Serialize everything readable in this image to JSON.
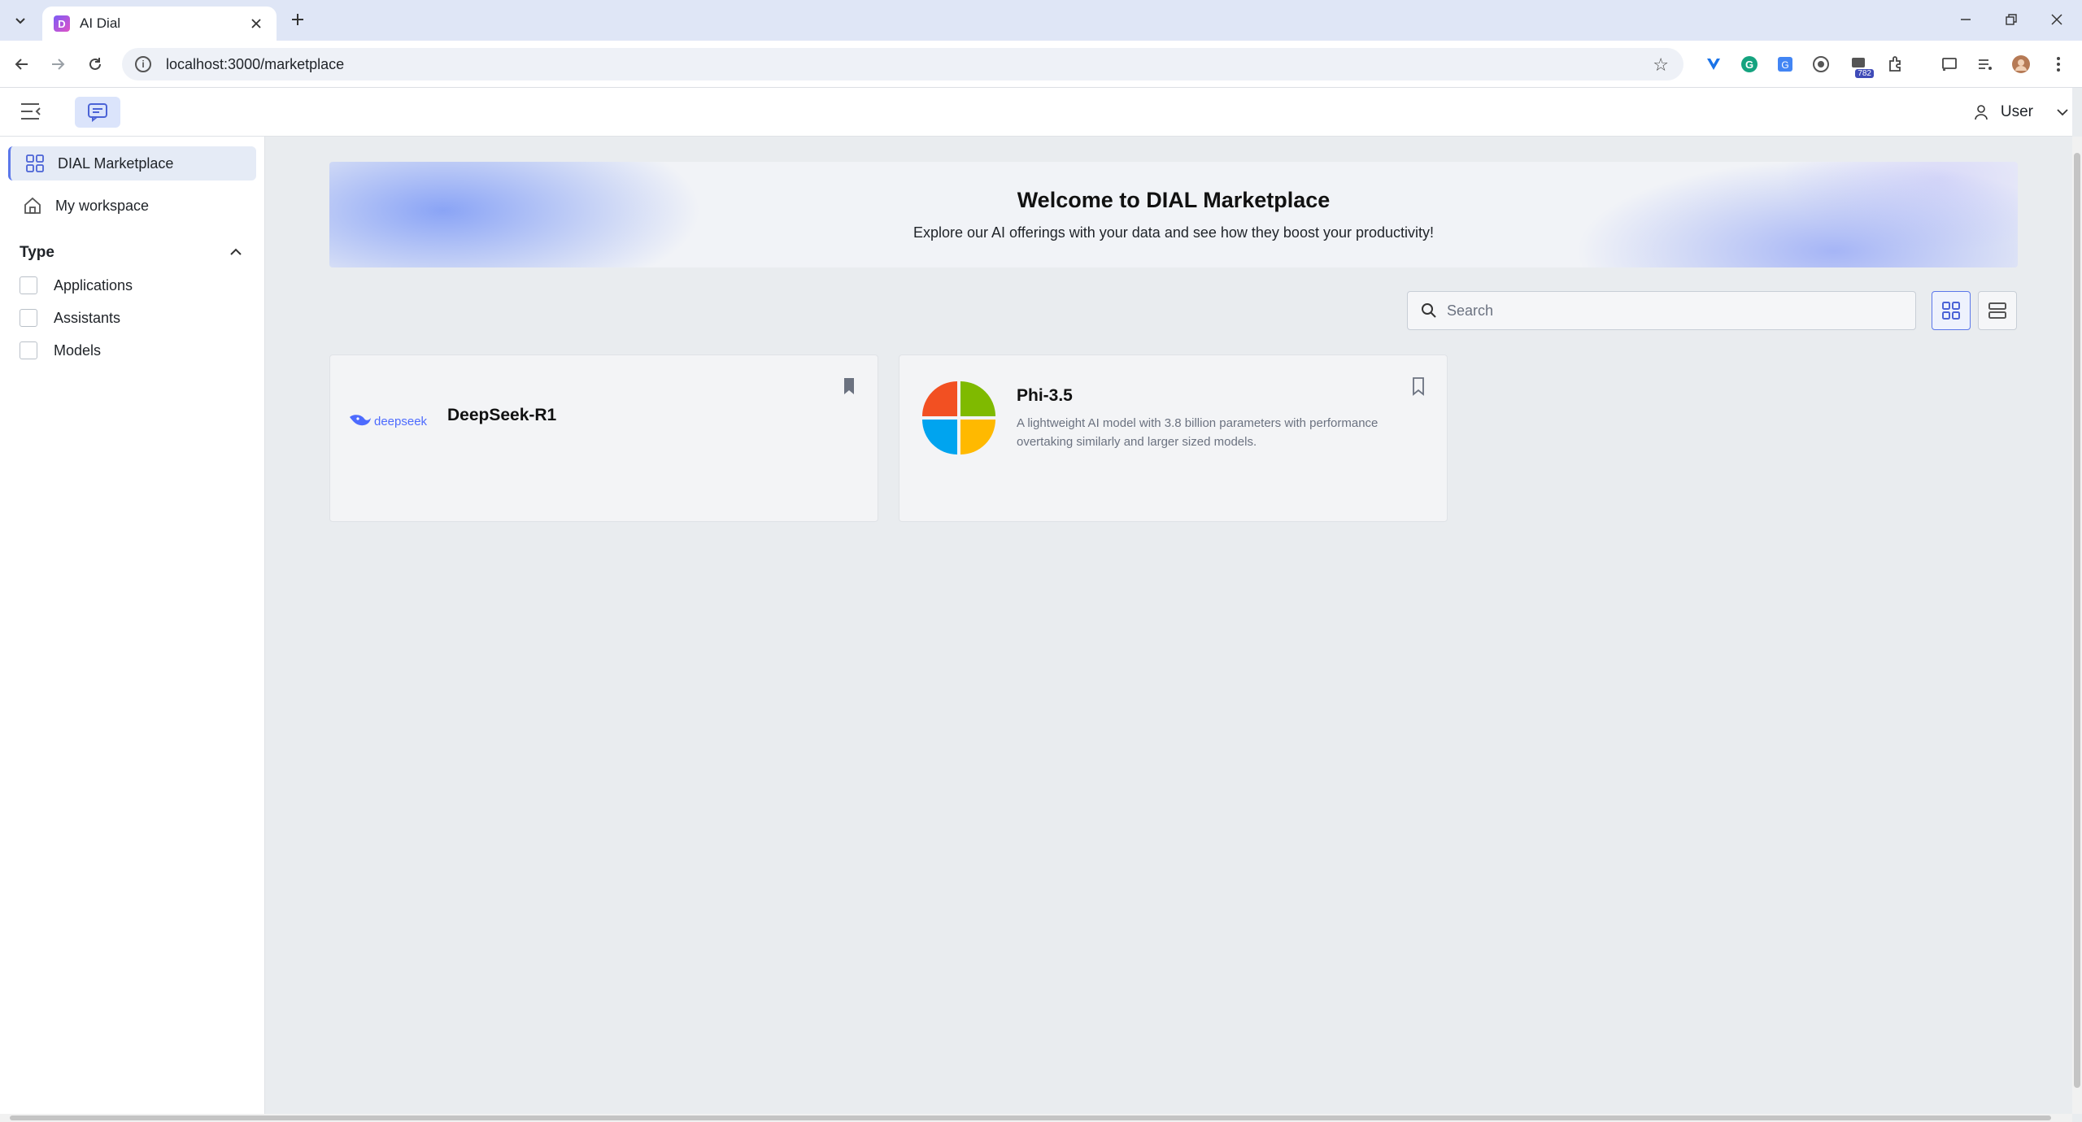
{
  "browser": {
    "tab_title": "AI Dial",
    "tab_favicon_letter": "D",
    "url": "localhost:3000/marketplace",
    "extension_badge": "782"
  },
  "header": {
    "user_label": "User"
  },
  "sidebar": {
    "items": [
      {
        "label": "DIAL Marketplace",
        "icon": "grid-icon",
        "active": true
      },
      {
        "label": "My workspace",
        "icon": "home-icon",
        "active": false
      }
    ],
    "filter": {
      "title": "Type",
      "options": [
        {
          "label": "Applications",
          "checked": false
        },
        {
          "label": "Assistants",
          "checked": false
        },
        {
          "label": "Models",
          "checked": false
        }
      ]
    }
  },
  "banner": {
    "title": "Welcome to DIAL Marketplace",
    "subtitle": "Explore our AI offerings with your data and see how they boost your productivity!"
  },
  "search": {
    "placeholder": "Search",
    "value": ""
  },
  "cards": [
    {
      "name": "DeepSeek-R1",
      "logo_text": "deepseek",
      "description": "",
      "bookmarked": true
    },
    {
      "name": "Phi-3.5",
      "logo_text": "",
      "description": "A lightweight AI model with 3.8 billion parameters with performance overtaking similarly and larger sized models.",
      "bookmarked": false
    }
  ],
  "colors": {
    "accent": "#5b77ea",
    "active_bg": "#e5ebf6"
  }
}
